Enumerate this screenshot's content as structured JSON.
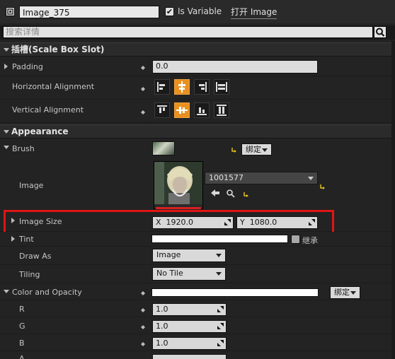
{
  "header": {
    "name_value": "Image_375",
    "is_variable_label": "Is Variable",
    "is_variable_checked": true,
    "open_image_label": "打开 Image"
  },
  "search": {
    "placeholder": "搜索详情"
  },
  "slot_section": {
    "title": "插槽(Scale Box Slot)",
    "padding_label": "Padding",
    "padding_value": "0.0",
    "halign_label": "Horizontal Alignment",
    "halign_selected_index": 1,
    "valign_label": "Vertical Alignment",
    "valign_selected_index": 1
  },
  "appearance_section": {
    "title": "Appearance",
    "brush_label": "Brush",
    "bind_label": "绑定",
    "image_label": "Image",
    "image_asset": "1001577",
    "image_size_label": "Image Size",
    "image_size_x_prefix": "X",
    "image_size_x": "1920.0",
    "image_size_y_prefix": "Y",
    "image_size_y": "1080.0",
    "tint_label": "Tint",
    "tint_inherit_label": "继承",
    "draw_as_label": "Draw As",
    "draw_as_value": "Image",
    "tiling_label": "Tiling",
    "tiling_value": "No Tile",
    "color_opacity_label": "Color and Opacity",
    "color_bind_label": "绑定",
    "r_label": "R",
    "r_value": "1.0",
    "g_label": "G",
    "g_value": "1.0",
    "b_label": "B",
    "b_value": "1.0",
    "a_label": "A"
  },
  "colors": {
    "accent": "#e8911f",
    "highlight_box": "#e01414",
    "reset_arrow": "#e0c020"
  }
}
